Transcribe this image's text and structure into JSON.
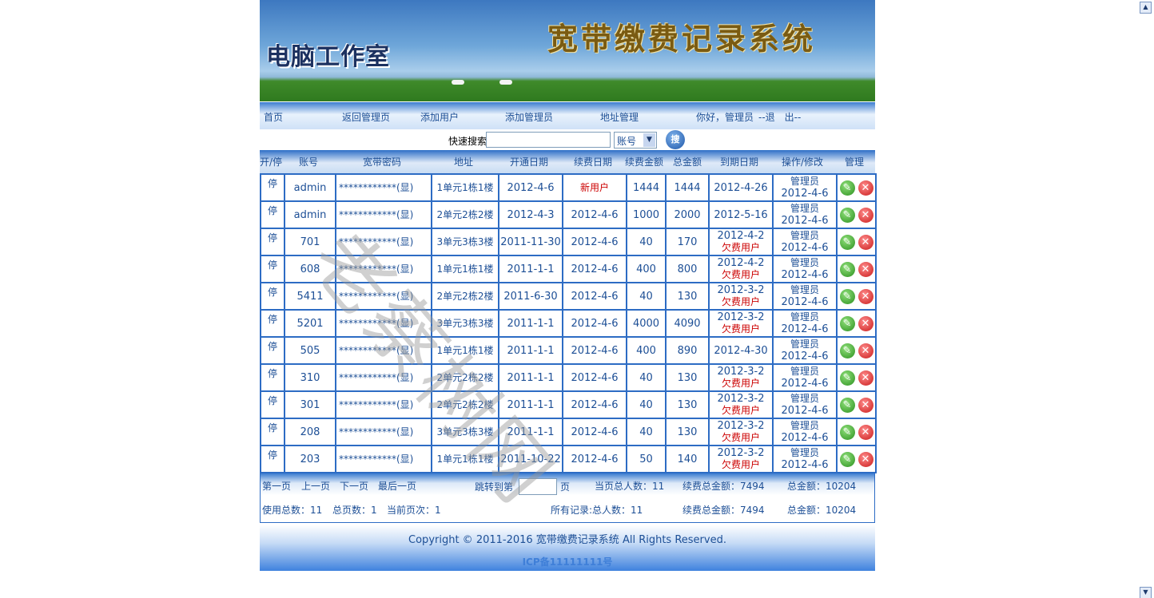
{
  "banner": {
    "system_title": "宽带缴费记录系统",
    "studio_name": "电脑工作室"
  },
  "nav": {
    "items": [
      "首页",
      "返回管理页",
      "添加用户",
      "添加管理员",
      "地址管理"
    ],
    "greeting": "你好，管理员",
    "logout": "--退　出--"
  },
  "search": {
    "label": "快速搜索",
    "value": "",
    "field_option": "账号",
    "button": "搜"
  },
  "columns": [
    "开/停",
    "账号",
    "宽带密码",
    "地址",
    "开通日期",
    "续费日期",
    "续费金额",
    "总金额",
    "到期日期",
    "操作/修改",
    "管理"
  ],
  "rows": [
    {
      "toggle": "停",
      "account": "admin",
      "password": "************(显)",
      "address": "1单元1栋1楼",
      "open_date": "2012-4-6",
      "renew_date": "",
      "renew_note": "新用户",
      "renew_amount": "1444",
      "total": "1444",
      "expire": "2012-4-26",
      "expire_note": "",
      "operator": "管理员",
      "op_date": "2012-4-6"
    },
    {
      "toggle": "停",
      "account": "admin",
      "password": "************(显)",
      "address": "2单元2栋2楼",
      "open_date": "2012-4-3",
      "renew_date": "2012-4-6",
      "renew_note": "",
      "renew_amount": "1000",
      "total": "2000",
      "expire": "2012-5-16",
      "expire_note": "",
      "operator": "管理员",
      "op_date": "2012-4-6"
    },
    {
      "toggle": "停",
      "account": "701",
      "password": "************(显)",
      "address": "3单元3栋3楼",
      "open_date": "2011-11-30",
      "renew_date": "2012-4-6",
      "renew_note": "",
      "renew_amount": "40",
      "total": "170",
      "expire": "2012-4-2",
      "expire_note": "欠费用户",
      "operator": "管理员",
      "op_date": "2012-4-6"
    },
    {
      "toggle": "停",
      "account": "608",
      "password": "************(显)",
      "address": "1单元1栋1楼",
      "open_date": "2011-1-1",
      "renew_date": "2012-4-6",
      "renew_note": "",
      "renew_amount": "400",
      "total": "800",
      "expire": "2012-4-2",
      "expire_note": "欠费用户",
      "operator": "管理员",
      "op_date": "2012-4-6"
    },
    {
      "toggle": "停",
      "account": "5411",
      "password": "************(显)",
      "address": "2单元2栋2楼",
      "open_date": "2011-6-30",
      "renew_date": "2012-4-6",
      "renew_note": "",
      "renew_amount": "40",
      "total": "130",
      "expire": "2012-3-2",
      "expire_note": "欠费用户",
      "operator": "管理员",
      "op_date": "2012-4-6"
    },
    {
      "toggle": "停",
      "account": "5201",
      "password": "************(显)",
      "address": "3单元3栋3楼",
      "open_date": "2011-1-1",
      "renew_date": "2012-4-6",
      "renew_note": "",
      "renew_amount": "4000",
      "total": "4090",
      "expire": "2012-3-2",
      "expire_note": "欠费用户",
      "operator": "管理员",
      "op_date": "2012-4-6"
    },
    {
      "toggle": "停",
      "account": "505",
      "password": "************(显)",
      "address": "1单元1栋1楼",
      "open_date": "2011-1-1",
      "renew_date": "2012-4-6",
      "renew_note": "",
      "renew_amount": "400",
      "total": "890",
      "expire": "2012-4-30",
      "expire_note": "",
      "operator": "管理员",
      "op_date": "2012-4-6"
    },
    {
      "toggle": "停",
      "account": "310",
      "password": "************(显)",
      "address": "2单元2栋2楼",
      "open_date": "2011-1-1",
      "renew_date": "2012-4-6",
      "renew_note": "",
      "renew_amount": "40",
      "total": "130",
      "expire": "2012-3-2",
      "expire_note": "欠费用户",
      "operator": "管理员",
      "op_date": "2012-4-6"
    },
    {
      "toggle": "停",
      "account": "301",
      "password": "************(显)",
      "address": "2单元2栋2楼",
      "open_date": "2011-1-1",
      "renew_date": "2012-4-6",
      "renew_note": "",
      "renew_amount": "40",
      "total": "130",
      "expire": "2012-3-2",
      "expire_note": "欠费用户",
      "operator": "管理员",
      "op_date": "2012-4-6"
    },
    {
      "toggle": "停",
      "account": "208",
      "password": "************(显)",
      "address": "3单元3栋3楼",
      "open_date": "2011-1-1",
      "renew_date": "2012-4-6",
      "renew_note": "",
      "renew_amount": "40",
      "total": "130",
      "expire": "2012-3-2",
      "expire_note": "欠费用户",
      "operator": "管理员",
      "op_date": "2012-4-6"
    },
    {
      "toggle": "停",
      "account": "203",
      "password": "************(显)",
      "address": "1单元1栋1楼",
      "open_date": "2011-10-22",
      "renew_date": "2012-4-6",
      "renew_note": "",
      "renew_amount": "50",
      "total": "140",
      "expire": "2012-3-2",
      "expire_note": "欠费用户",
      "operator": "管理员",
      "op_date": "2012-4-6"
    }
  ],
  "row_icons": {
    "edit": "edit-icon",
    "delete": "delete-icon"
  },
  "pager": {
    "first": "第一页",
    "prev": "上一页",
    "next": "下一页",
    "last": "最后一页",
    "jump_label": "跳转到第",
    "jump_value": "",
    "jump_unit": "页",
    "page_users": "当页总人数：11",
    "page_renew_total": "续费总金额：7494",
    "page_total": "总金额：10204",
    "usage_total": "使用总数：11",
    "page_count": "总页数：1",
    "current_page": "当前页次：1",
    "all_records": "所有记录:总人数：11",
    "all_renew_total": "续费总金额：7494",
    "all_total": "总金额：10204"
  },
  "footer": {
    "copyright": "Copyright © 2011-2016   宽带缴费记录系统  All Rights Reserved.",
    "icp": "ICP备11111111号"
  },
  "watermark": "老蔡树网",
  "colors": {
    "primary": "#2d6cc4",
    "text": "#1d4f96",
    "warning": "#cc0000"
  }
}
